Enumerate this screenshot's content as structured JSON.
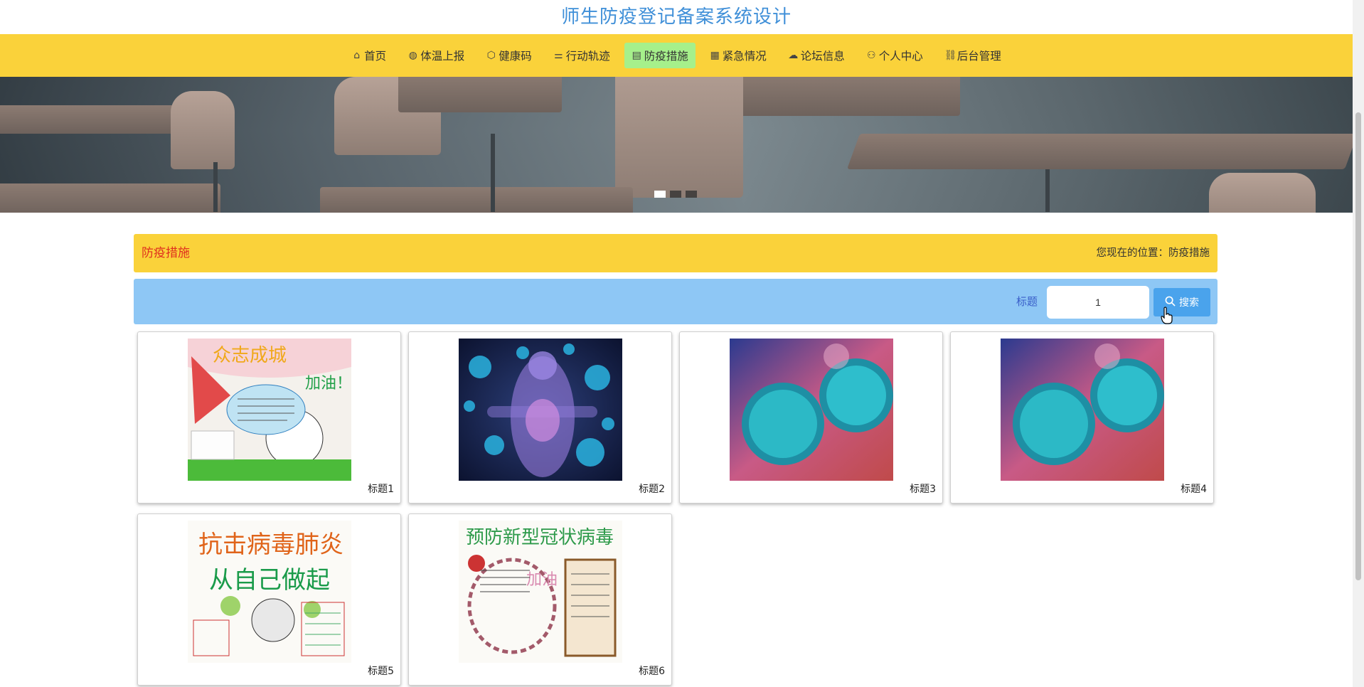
{
  "site": {
    "title": "师生防疫登记备案系统设计"
  },
  "nav": [
    {
      "icon": "home-icon",
      "label": "首页",
      "active": false
    },
    {
      "icon": "globe-icon",
      "label": "体温上报",
      "active": false
    },
    {
      "icon": "cube-icon",
      "label": "健康码",
      "active": false
    },
    {
      "icon": "sliders-icon",
      "label": "行动轨迹",
      "active": false
    },
    {
      "icon": "clipboard-icon",
      "label": "防疫措施",
      "active": true
    },
    {
      "icon": "grid-icon",
      "label": "紧急情况",
      "active": false
    },
    {
      "icon": "cloud-icon",
      "label": "论坛信息",
      "active": false
    },
    {
      "icon": "user-icon",
      "label": "个人中心",
      "active": false
    },
    {
      "icon": "link-icon",
      "label": "后台管理",
      "active": false
    }
  ],
  "banner": {
    "slide_count": 3,
    "active_slide": 1
  },
  "section": {
    "title": "防疫措施",
    "breadcrumb": "您现在的位置：防疫措施"
  },
  "search": {
    "label": "标题",
    "value": "1",
    "button_label": "搜索"
  },
  "cards": [
    {
      "title": "标题1",
      "image": "poster-united-fight"
    },
    {
      "title": "标题2",
      "image": "virus-human-body"
    },
    {
      "title": "标题3",
      "image": "coronavirus-particles"
    },
    {
      "title": "标题4",
      "image": "coronavirus-particles"
    },
    {
      "title": "标题5",
      "image": "poster-fight-pneumonia"
    },
    {
      "title": "标题6",
      "image": "poster-prevent-coronavirus"
    }
  ],
  "poster_text": {
    "p1_top": "众志成城",
    "p1_side": "加油！",
    "p5_line1": "抗击病毒肺炎",
    "p5_line2": "从自己做起",
    "p6_top": "预防新型冠状病毒",
    "p6_side": "加油"
  },
  "colors": {
    "title_blue": "#3f8fd8",
    "nav_yellow": "#fad23a",
    "nav_active": "#a6f08b",
    "section_red": "#e0301e",
    "search_bar": "#8ec7f5",
    "button_blue": "#4aa3ec"
  }
}
